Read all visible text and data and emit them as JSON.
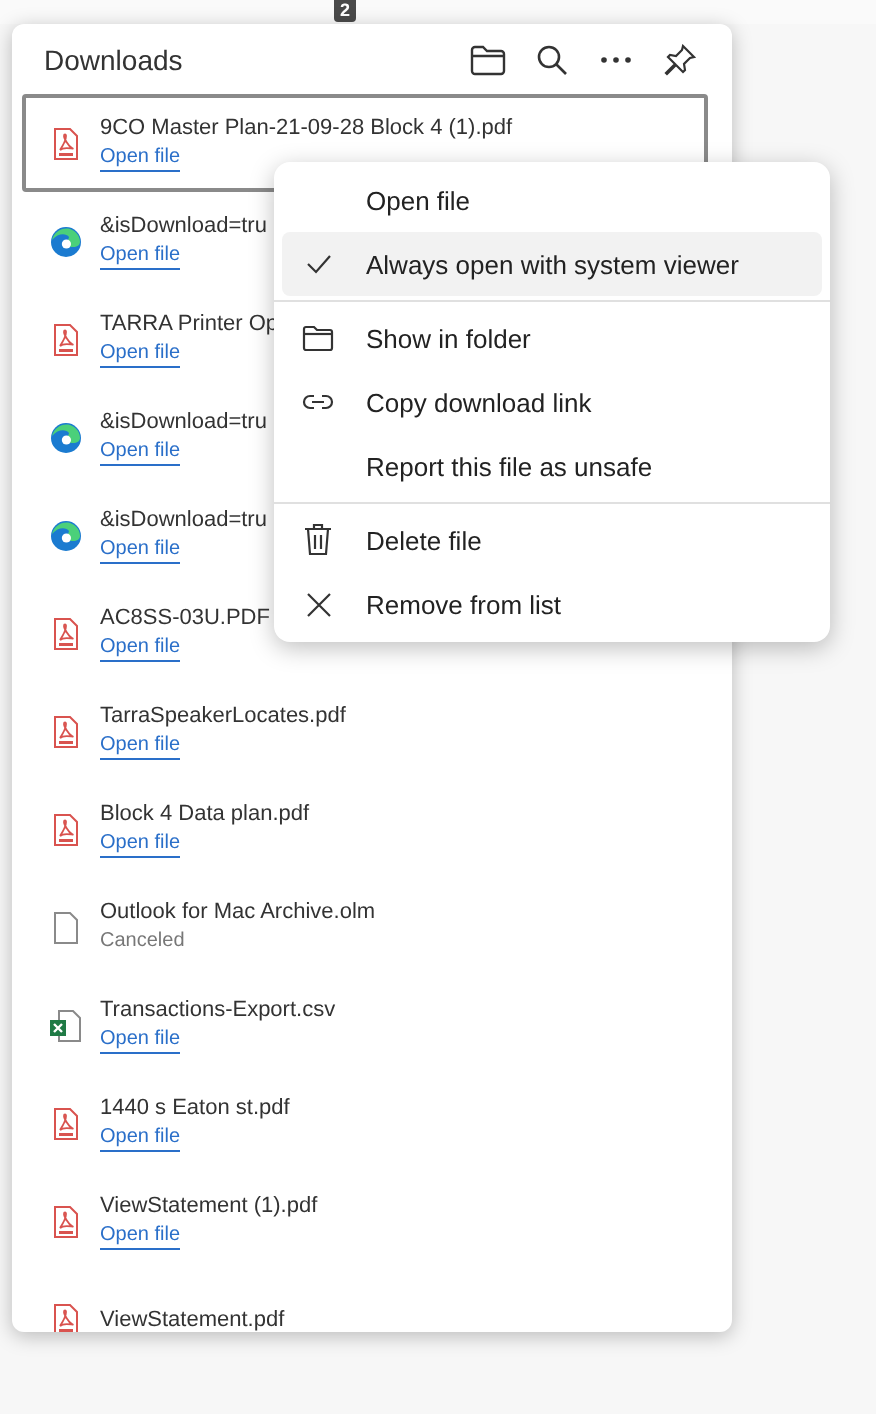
{
  "toolbar": {
    "badge": "2"
  },
  "panel": {
    "title": "Downloads"
  },
  "downloads": [
    {
      "name": "9CO Master Plan-21-09-28 Block 4 (1).pdf",
      "kind": "pdf",
      "status": {
        "kind": "link",
        "text": "Open file"
      },
      "selected": true
    },
    {
      "name": "&isDownload=tru",
      "kind": "edge",
      "status": {
        "kind": "link",
        "text": "Open file"
      },
      "selected": false
    },
    {
      "name": "TARRA Printer Op",
      "kind": "pdf",
      "status": {
        "kind": "link",
        "text": "Open file"
      },
      "selected": false
    },
    {
      "name": "&isDownload=tru",
      "kind": "edge",
      "status": {
        "kind": "link",
        "text": "Open file"
      },
      "selected": false
    },
    {
      "name": "&isDownload=tru",
      "kind": "edge",
      "status": {
        "kind": "link",
        "text": "Open file"
      },
      "selected": false
    },
    {
      "name": "AC8SS-03U.PDF",
      "kind": "pdf",
      "status": {
        "kind": "link",
        "text": "Open file"
      },
      "selected": false
    },
    {
      "name": "TarraSpeakerLocates.pdf",
      "kind": "pdf",
      "status": {
        "kind": "link",
        "text": "Open file"
      },
      "selected": false
    },
    {
      "name": "Block 4 Data plan.pdf",
      "kind": "pdf",
      "status": {
        "kind": "link",
        "text": "Open file"
      },
      "selected": false
    },
    {
      "name": "Outlook for Mac Archive.olm",
      "kind": "generic",
      "status": {
        "kind": "text",
        "text": "Canceled"
      },
      "selected": false
    },
    {
      "name": "Transactions-Export.csv",
      "kind": "excel",
      "status": {
        "kind": "link",
        "text": "Open file"
      },
      "selected": false
    },
    {
      "name": "1440 s Eaton st.pdf",
      "kind": "pdf",
      "status": {
        "kind": "link",
        "text": "Open file"
      },
      "selected": false
    },
    {
      "name": "ViewStatement (1).pdf",
      "kind": "pdf",
      "status": {
        "kind": "link",
        "text": "Open file"
      },
      "selected": false
    },
    {
      "name": "ViewStatement.pdf",
      "kind": "pdf",
      "selected": false
    }
  ],
  "context_menu": [
    {
      "label": "Open file",
      "kind": "plain",
      "checked": false,
      "selected": false
    },
    {
      "label": "Always open with system viewer",
      "kind": "plain",
      "checked": true,
      "selected": true
    },
    {
      "kind": "divider"
    },
    {
      "label": "Show in folder",
      "kind": "folder",
      "checked": false,
      "selected": false
    },
    {
      "label": "Copy download link",
      "kind": "link",
      "checked": false,
      "selected": false
    },
    {
      "label": "Report this file as unsafe",
      "kind": "plain",
      "checked": false,
      "selected": false
    },
    {
      "kind": "divider"
    },
    {
      "label": "Delete file",
      "kind": "trash",
      "checked": false,
      "selected": false
    },
    {
      "label": "Remove from list",
      "kind": "remove",
      "checked": false,
      "selected": false
    }
  ]
}
